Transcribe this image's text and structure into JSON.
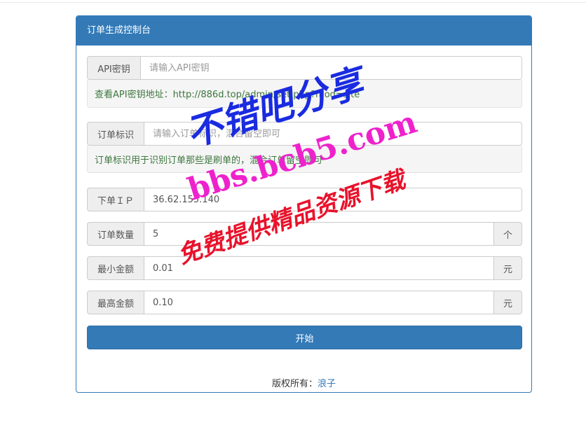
{
  "panel": {
    "title": "订单生成控制台"
  },
  "api_key": {
    "label": "API密钥",
    "placeholder": "请输入API密钥",
    "value": "",
    "help": "查看API密钥地址：http://886d.top/admin/set.php?mod=site"
  },
  "order_tag": {
    "label": "订单标识",
    "placeholder": "请输入订单标识，混合留空即可",
    "value": "",
    "help": "订单标识用于识别订单那些是刷单的，混合订单留空即可"
  },
  "order_ip": {
    "label": "下单ＩＰ",
    "value": "36.62.155.140"
  },
  "order_count": {
    "label": "订单数量",
    "value": "5",
    "unit": "个"
  },
  "min_amount": {
    "label": "最小金额",
    "value": "0.01",
    "unit": "元"
  },
  "max_amount": {
    "label": "最高金额",
    "value": "0.10",
    "unit": "元"
  },
  "start_button": {
    "label": "开始"
  },
  "footer": {
    "copyright": "版权所有：",
    "author": "浪子"
  },
  "watermark": {
    "line1": "不错吧分享",
    "line2": "bbs.bcb5.com",
    "line3": "免费提供精品资源下载"
  },
  "colors": {
    "primary": "#337ab7",
    "help_text": "#3c763d",
    "watermark_blue": "#1a2be0",
    "watermark_pink": "#ee22cc",
    "watermark_red": "#e8122b"
  }
}
